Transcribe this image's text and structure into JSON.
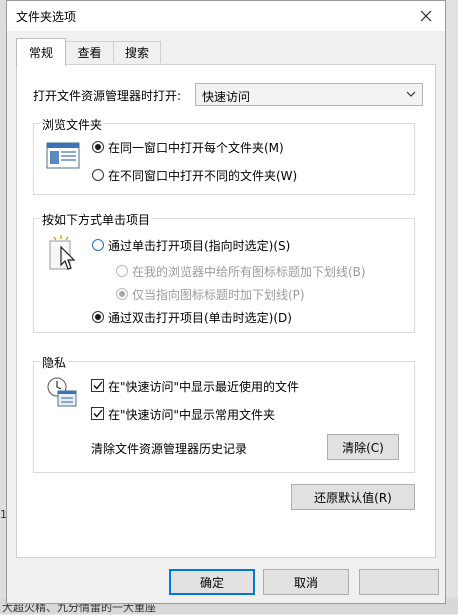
{
  "window": {
    "title": "文件夹选项"
  },
  "tabs": [
    {
      "label": "常规"
    },
    {
      "label": "查看"
    },
    {
      "label": "搜索"
    }
  ],
  "general": {
    "open_label": "打开文件资源管理器时打开:",
    "open_value": "快速访问",
    "browse": {
      "legend": "浏览文件夹",
      "options": [
        {
          "label": "在同一窗口中打开每个文件夹(M)",
          "checked": true
        },
        {
          "label": "在不同窗口中打开不同的文件夹(W)",
          "checked": false
        }
      ]
    },
    "click": {
      "legend": "按如下方式单击项目",
      "single": "通过单击打开项目(指向时选定)(S)",
      "underline_browser": "在我的浏览器中给所有图标标题加下划线(B)",
      "underline_hover": "仅当指向图标标题时加下划线(P)",
      "double": "通过双击打开项目(单击时选定)(D)"
    },
    "privacy": {
      "legend": "隐私",
      "recent_files": "在\"快速访问\"中显示最近使用的文件",
      "frequent_folders": "在\"快速访问\"中显示常用文件夹",
      "clear_label": "清除文件资源管理器历史记录",
      "clear_button": "清除(C)"
    },
    "restore_button": "还原默认值(R)"
  },
  "footer": {
    "ok": "确定",
    "cancel": "取消"
  },
  "background": {
    "left_text": "1.",
    "bottom_text": "大超火精、九分情雷的一大重座"
  }
}
